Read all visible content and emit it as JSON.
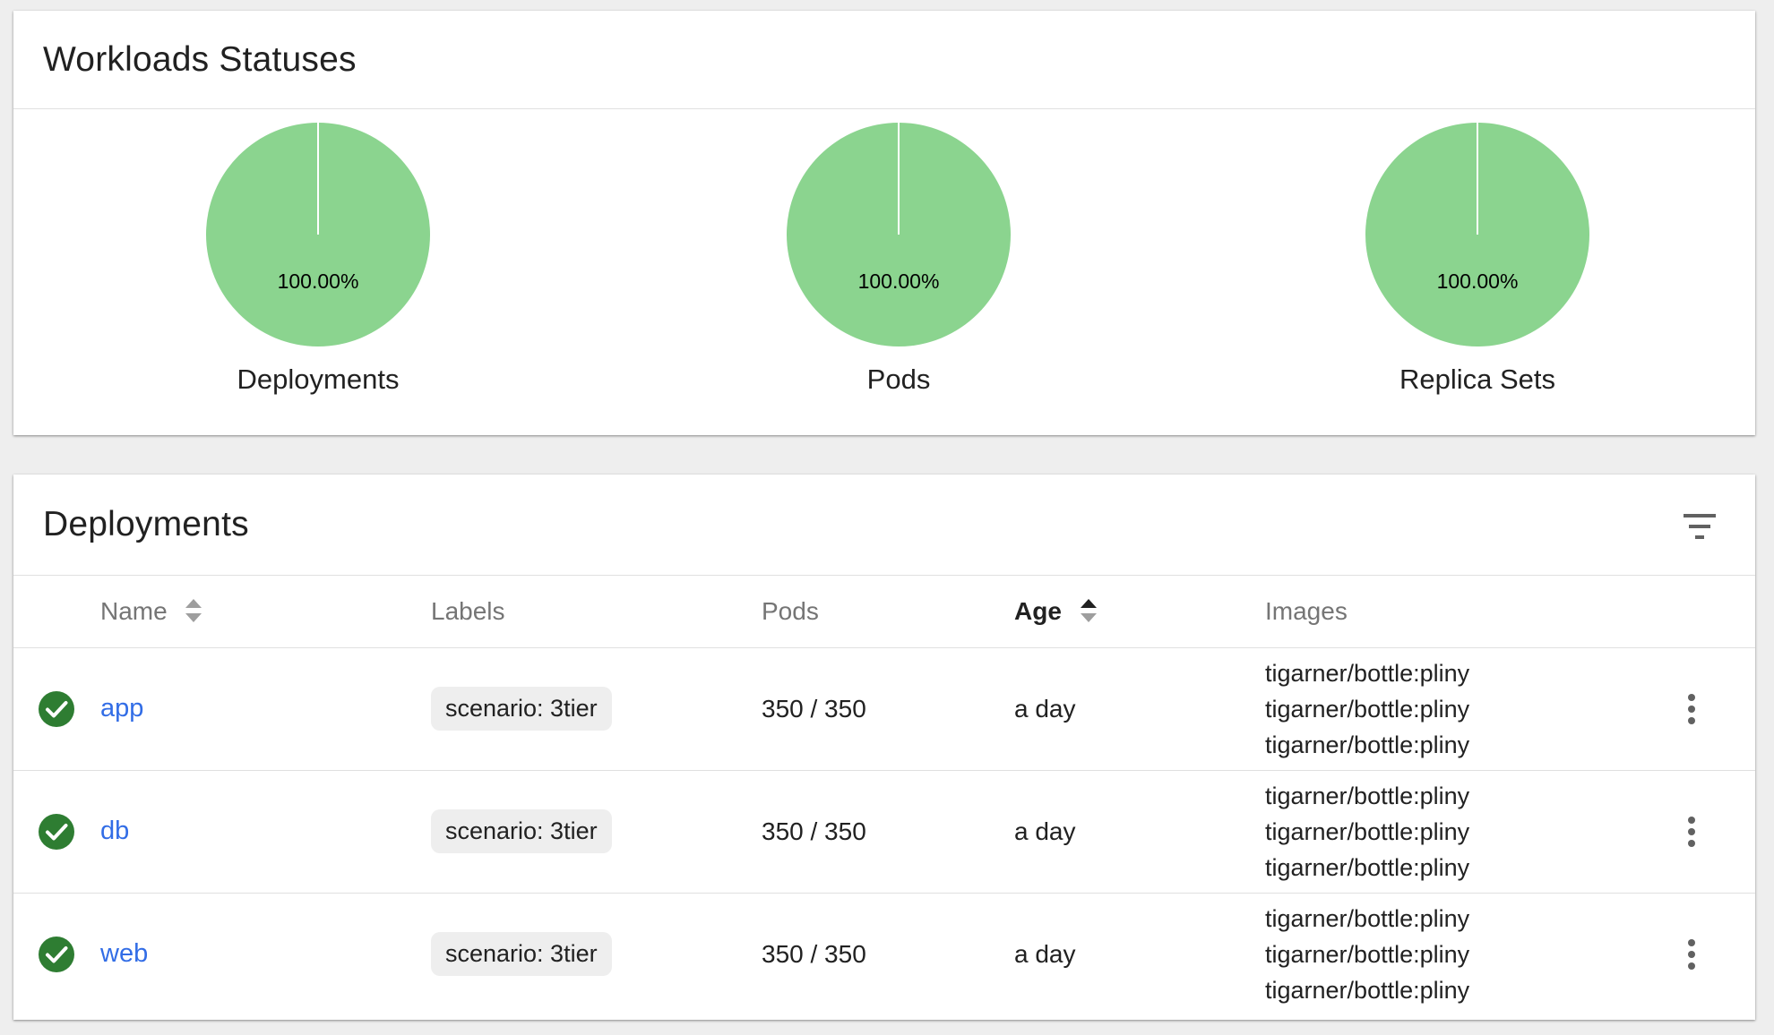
{
  "status_card": {
    "title": "Workloads Statuses",
    "charts": [
      {
        "label": "Deployments",
        "percent_text": "100.00%",
        "success_fraction": 1.0
      },
      {
        "label": "Pods",
        "percent_text": "100.00%",
        "success_fraction": 1.0
      },
      {
        "label": "Replica Sets",
        "percent_text": "100.00%",
        "success_fraction": 1.0
      }
    ],
    "colors": {
      "success": "#8bd48f"
    }
  },
  "deployments": {
    "title": "Deployments",
    "columns": {
      "name": "Name",
      "labels": "Labels",
      "pods": "Pods",
      "age": "Age",
      "images": "Images"
    },
    "sorted_column": "Age",
    "rows": [
      {
        "status": "success",
        "name": "app",
        "label": "scenario: 3tier",
        "pods": "350 / 350",
        "age": "a day",
        "images": [
          "tigarner/bottle:pliny",
          "tigarner/bottle:pliny",
          "tigarner/bottle:pliny"
        ]
      },
      {
        "status": "success",
        "name": "db",
        "label": "scenario: 3tier",
        "pods": "350 / 350",
        "age": "a day",
        "images": [
          "tigarner/bottle:pliny",
          "tigarner/bottle:pliny",
          "tigarner/bottle:pliny"
        ]
      },
      {
        "status": "success",
        "name": "web",
        "label": "scenario: 3tier",
        "pods": "350 / 350",
        "age": "a day",
        "images": [
          "tigarner/bottle:pliny",
          "tigarner/bottle:pliny",
          "tigarner/bottle:pliny"
        ]
      }
    ],
    "colors": {
      "link": "#326de6",
      "status_ok": "#2e7d32"
    },
    "icons": {
      "filter": "filter-icon",
      "menu": "more-vert-icon",
      "status": "check-circle-icon",
      "sort": "sort-icon"
    }
  }
}
